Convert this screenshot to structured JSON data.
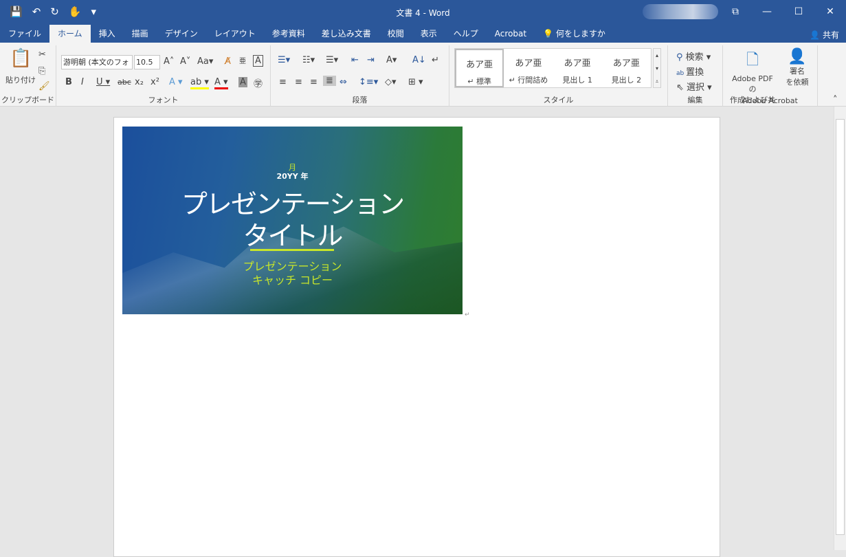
{
  "titlebar": {
    "title": "文書 4  -  Word",
    "qat": [
      "💾",
      "↶",
      "↻",
      "✋",
      "▾"
    ],
    "buttons": [
      "⧉",
      "—",
      "☐",
      "✕"
    ]
  },
  "tabs": [
    "ファイル",
    "ホーム",
    "挿入",
    "描画",
    "デザイン",
    "レイアウト",
    "参考資料",
    "差し込み文書",
    "校閲",
    "表示",
    "ヘルプ",
    "Acrobat"
  ],
  "tellme": "何をしますか",
  "share": "共有",
  "ribbon": {
    "clipboard": {
      "paste": "貼り付け",
      "label": "クリップボード"
    },
    "font": {
      "name": "游明朝 (本文のフォ",
      "size": "10.5",
      "label": "フォント"
    },
    "paragraph": {
      "label": "段落"
    },
    "styles": {
      "items": [
        {
          "preview": "あア亜",
          "name": "↵ 標準"
        },
        {
          "preview": "あア亜",
          "name": "↵ 行間詰め"
        },
        {
          "preview": "あア亜",
          "name": "見出し 1"
        },
        {
          "preview": "あア亜",
          "name": "見出し 2"
        }
      ],
      "label": "スタイル"
    },
    "editing": {
      "find": "検索",
      "replace": "置換",
      "select": "選択",
      "label": "編集"
    },
    "acrobat": {
      "create": "Adobe PDF の",
      "create2": "作成および共有",
      "sign": "署名",
      "sign2": "を依頼",
      "label": "Adobe Acrobat"
    }
  },
  "document": {
    "image": {
      "month": "月",
      "year": "20YY 年",
      "title1": "プレゼンテーション",
      "title2": "タイトル",
      "sub1": "プレゼンテーション",
      "sub2": "キャッチ コピー",
      "accent": "#c8e62a"
    }
  }
}
